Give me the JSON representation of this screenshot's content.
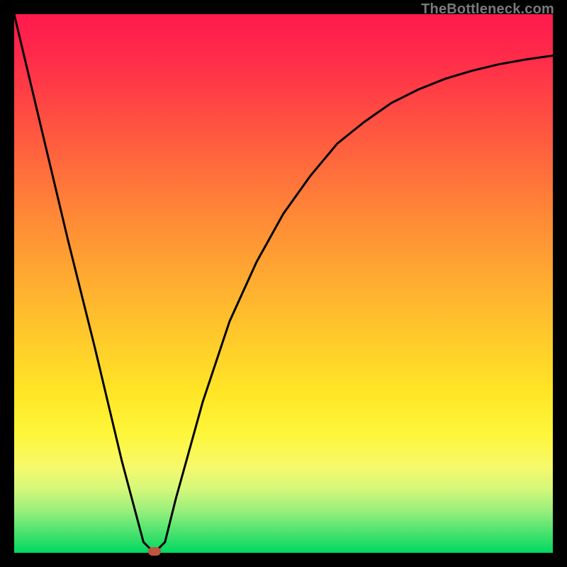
{
  "watermark": "TheBottleneck.com",
  "colors": {
    "frame": "#000000",
    "curve": "#000000",
    "marker": "#c1543f",
    "gradient_top": "#ff1a4d",
    "gradient_bottom": "#00d85f"
  },
  "chart_data": {
    "type": "line",
    "title": "",
    "xlabel": "",
    "ylabel": "",
    "xlim": [
      0,
      100
    ],
    "ylim": [
      0,
      100
    ],
    "grid": false,
    "legend": false,
    "annotations": [],
    "x": [
      0,
      5,
      10,
      15,
      20,
      24,
      26,
      28,
      30,
      35,
      40,
      45,
      50,
      55,
      60,
      65,
      70,
      75,
      80,
      85,
      90,
      95,
      100
    ],
    "y": [
      100,
      79,
      58,
      38,
      17,
      2,
      0,
      2,
      10,
      28,
      43,
      54,
      63,
      70,
      76,
      80,
      83.5,
      86,
      88,
      89.5,
      90.7,
      91.6,
      92.3
    ],
    "minimum_marker": {
      "x": 26,
      "y": 0
    }
  }
}
